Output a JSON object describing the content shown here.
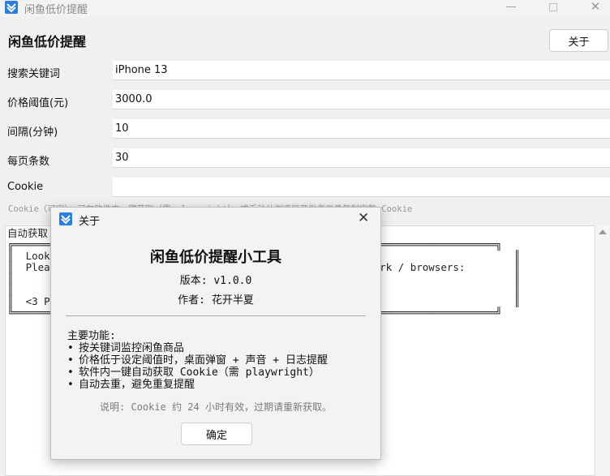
{
  "window": {
    "title": "闲鱼低价提醒",
    "minimize_glyph": "—",
    "close_glyph": "✕"
  },
  "header": {
    "title": "闲鱼低价提醒",
    "about_label": "关于"
  },
  "form": {
    "fields": [
      {
        "label": "搜索关键词",
        "value": "iPhone 13"
      },
      {
        "label": "价格阈值(元)",
        "value": "3000.0"
      },
      {
        "label": "间隔(分钟)",
        "value": "10"
      },
      {
        "label": "每页条数",
        "value": "30"
      },
      {
        "label": "Cookie",
        "value": ""
      }
    ],
    "cookie_hint": "Cookie（可空）：可在软件内一键获取（需 playwright），或手动从浏览器开发者工具复制完整 Cookie"
  },
  "log": {
    "text": "自动获取 Cookie ...\n╔═══════════════════════════════════════════════════════════════════════════════╗\n║  Looking for Playwright Chromium ...                                             ║\n║  Please run: playwright install chromium    (requires network / browsers:        ║\n║                                                                                  ║\n║                                                                                  ║\n║  <3 Playwright                                                                   ║\n╚═══════════════════════════════════════════════════════════════════════════════╝"
  },
  "dialog": {
    "title": "关于",
    "close_glyph": "✕",
    "heading": "闲鱼低价提醒小工具",
    "version": "版本: v1.0.0",
    "author": "作者: 花开半夏",
    "features_title": "主要功能:",
    "features": [
      "按关键词监控闲鱼商品",
      "价格低于设定阈值时，桌面弹窗 + 声音 + 日志提醒",
      "软件内一键自动获取 Cookie（需 playwright）",
      "自动去重，避免重复提醒"
    ],
    "note": "说明: Cookie 约 24 小时有效，过期请重新获取。",
    "ok_label": "确定"
  },
  "colors": {
    "accent": "#2a7de1",
    "background": "#f0f0f0",
    "input_background": "#ffffff"
  },
  "icons": {
    "app": "xianyu-app-icon",
    "minimize": "minimize-icon",
    "maximize": "maximize-icon",
    "close": "close-icon"
  }
}
